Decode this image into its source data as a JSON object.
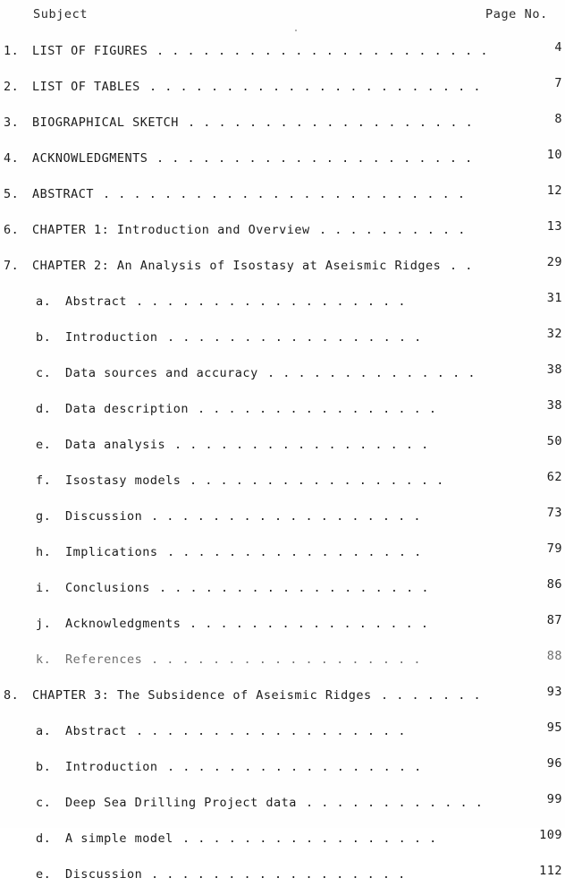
{
  "document": {
    "header": {
      "subject_label": "Subject",
      "page_number_label": "Page No."
    },
    "entries": [
      {
        "level": 1,
        "marker": "1.",
        "title": "LIST OF FIGURES",
        "page": "4",
        "leader_dots": 22,
        "faded": false
      },
      {
        "level": 1,
        "marker": "2.",
        "title": "LIST OF TABLES",
        "page": "7",
        "leader_dots": 22,
        "faded": false
      },
      {
        "level": 1,
        "marker": "3.",
        "title": "BIOGRAPHICAL SKETCH",
        "page": "8",
        "leader_dots": 19,
        "faded": false
      },
      {
        "level": 1,
        "marker": "4.",
        "title": "ACKNOWLEDGMENTS",
        "page": "10",
        "leader_dots": 21,
        "faded": false
      },
      {
        "level": 1,
        "marker": "5.",
        "title": "ABSTRACT",
        "page": "12",
        "leader_dots": 24,
        "faded": false
      },
      {
        "level": 1,
        "marker": "6.",
        "title": "CHAPTER 1:  Introduction and Overview",
        "page": "13",
        "leader_dots": 10,
        "faded": false
      },
      {
        "level": 1,
        "marker": "7.",
        "title": "CHAPTER 2:  An Analysis of Isostasy at Aseismic Ridges",
        "page": "29",
        "leader_dots": 2,
        "faded": false
      },
      {
        "level": 2,
        "marker": "a.",
        "title": "Abstract",
        "page": "31",
        "leader_dots": 18,
        "faded": false
      },
      {
        "level": 2,
        "marker": "b.",
        "title": "Introduction",
        "page": "32",
        "leader_dots": 17,
        "faded": false
      },
      {
        "level": 2,
        "marker": "c.",
        "title": "Data sources and accuracy",
        "page": "38",
        "leader_dots": 14,
        "faded": false
      },
      {
        "level": 2,
        "marker": "d.",
        "title": "Data description",
        "page": "38",
        "leader_dots": 16,
        "faded": false
      },
      {
        "level": 2,
        "marker": "e.",
        "title": "Data analysis",
        "page": "50",
        "leader_dots": 17,
        "faded": false
      },
      {
        "level": 2,
        "marker": "f.",
        "title": "Isostasy models",
        "page": "62",
        "leader_dots": 17,
        "faded": false
      },
      {
        "level": 2,
        "marker": "g.",
        "title": "Discussion",
        "page": "73",
        "leader_dots": 18,
        "faded": false
      },
      {
        "level": 2,
        "marker": "h.",
        "title": "Implications",
        "page": "79",
        "leader_dots": 17,
        "faded": false
      },
      {
        "level": 2,
        "marker": "i.",
        "title": "Conclusions",
        "page": "86",
        "leader_dots": 18,
        "faded": false
      },
      {
        "level": 2,
        "marker": "j.",
        "title": "Acknowledgments",
        "page": "87",
        "leader_dots": 16,
        "faded": false
      },
      {
        "level": 2,
        "marker": "k.",
        "title": "References",
        "page": "88",
        "leader_dots": 18,
        "faded": true
      },
      {
        "level": 1,
        "marker": "8.",
        "title": "CHAPTER 3:  The Subsidence of Aseismic Ridges",
        "page": "93",
        "leader_dots": 7,
        "faded": false
      },
      {
        "level": 2,
        "marker": "a.",
        "title": "Abstract",
        "page": "95",
        "leader_dots": 18,
        "faded": false
      },
      {
        "level": 2,
        "marker": "b.",
        "title": "Introduction",
        "page": "96",
        "leader_dots": 17,
        "faded": false
      },
      {
        "level": 2,
        "marker": "c.",
        "title": "Deep Sea Drilling Project  data",
        "page": "99",
        "leader_dots": 12,
        "faded": false
      },
      {
        "level": 2,
        "marker": "d.",
        "title": "A simple model",
        "page": "109",
        "leader_dots": 17,
        "faded": false
      },
      {
        "level": 2,
        "marker": "e.",
        "title": "Discussion",
        "page": "112",
        "leader_dots": 17,
        "faded": false
      }
    ]
  }
}
